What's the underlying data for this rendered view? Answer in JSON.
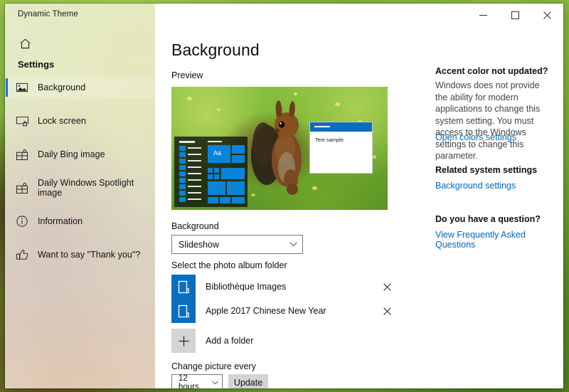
{
  "window": {
    "title": "Dynamic Theme",
    "controls": [
      {
        "name": "minimize-button",
        "label": "─"
      },
      {
        "name": "maximize-button",
        "label": "□"
      },
      {
        "name": "close-button",
        "label": "✕"
      }
    ]
  },
  "sidebar": {
    "home_label": "Home",
    "heading": "Settings",
    "items": [
      {
        "label": "Background",
        "icon": "picture-icon",
        "selected": true
      },
      {
        "label": "Lock screen",
        "icon": "lock-screen-icon",
        "selected": false
      },
      {
        "label": "Daily Bing image",
        "icon": "gift-icon",
        "selected": false
      },
      {
        "label": "Daily Windows Spotlight image",
        "icon": "gift-icon",
        "selected": false
      },
      {
        "label": "Information",
        "icon": "info-circle-icon",
        "selected": false
      },
      {
        "label": "Want to say \"Thank you\"?",
        "icon": "thumbs-up-icon",
        "selected": false
      }
    ]
  },
  "main": {
    "page_title": "Background",
    "preview_label": "Preview",
    "preview": {
      "sample_window_text": "Text sample",
      "start_tile_text": "Aa"
    },
    "background_label": "Background",
    "background_value": "Slideshow",
    "folder_section_label": "Select the photo album folder",
    "folders": [
      {
        "name": "Bibliothèque Images",
        "remove_label": "✕"
      },
      {
        "name": "Apple 2017 Chinese New Year",
        "remove_label": "✕"
      }
    ],
    "add_folder_label": "Add a folder",
    "add_folder_icon": "plus-icon",
    "change_picture_label": "Change picture every",
    "change_picture_value": "12 hours",
    "update_label": "Update"
  },
  "info": {
    "accent_heading": "Accent color not updated?",
    "accent_body": "Windows does not provide the ability for modern applications to change this system setting. You must access to the Windows settings to change this parameter.",
    "accent_link": "Open colors settings",
    "related_heading": "Related system settings",
    "related_link": "Background settings",
    "question_heading": "Do you have a question?",
    "question_link": "View Frequently Asked Questions"
  },
  "colors": {
    "accent": "#0078d7",
    "link": "#0067b8",
    "tile": "#0a84d8",
    "folder_icon": "#0a6ebd"
  }
}
